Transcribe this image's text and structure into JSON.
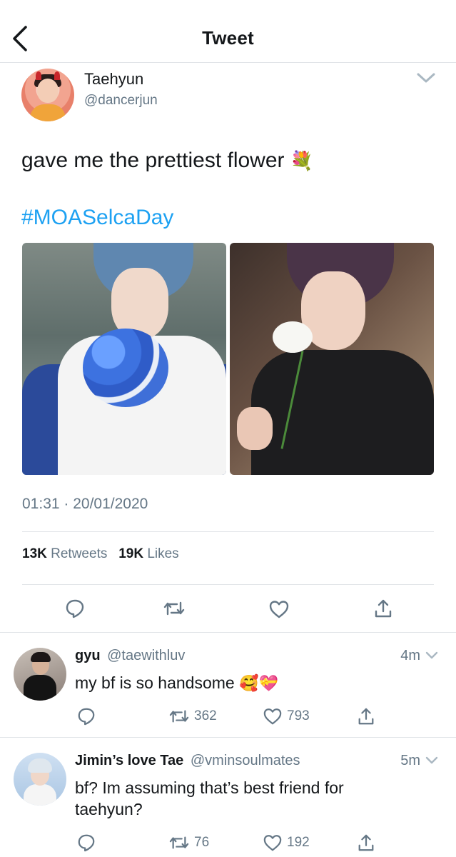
{
  "header": {
    "title": "Tweet"
  },
  "tweet": {
    "author_name": "Taehyun",
    "author_handle": "@dancerjun",
    "text": "gave me the prettiest flower",
    "text_emoji": "💐",
    "hashtag": "#MOASelcaDay",
    "timestamp": "01:31 · 20/01/2020",
    "retweets_count": "13K",
    "retweets_label": "Retweets",
    "likes_count": "19K",
    "likes_label": "Likes"
  },
  "replies": [
    {
      "name": "gyu",
      "handle": "@taewithluv",
      "time": "4m",
      "text": "my bf is so handsome",
      "emoji": "🥰💝",
      "retweets": "362",
      "likes": "793"
    },
    {
      "name": "Jimin’s love Tae",
      "handle": "@vminsoulmates",
      "time": "5m",
      "text": "bf? Im assuming that’s best friend for taehyun?",
      "emoji": "",
      "retweets": "76",
      "likes": "192"
    }
  ],
  "colors": {
    "accent": "#1da1f2",
    "text_primary": "#14171a",
    "text_secondary": "#657786",
    "divider": "#e1e4e8"
  },
  "icons": [
    "back-arrow-icon",
    "chevron-down-icon",
    "reply-icon",
    "retweet-icon",
    "like-icon",
    "share-icon"
  ]
}
